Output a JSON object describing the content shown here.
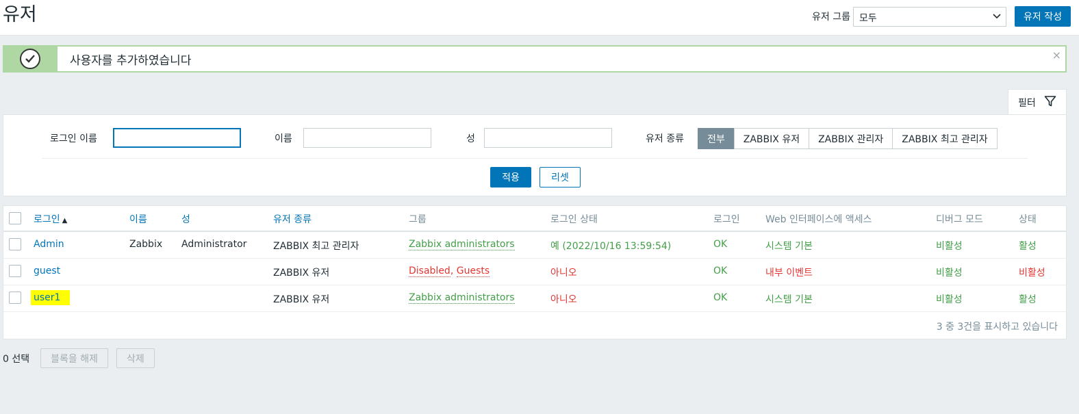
{
  "header": {
    "title": "유저",
    "group_label": "유저 그룹",
    "group_value": "모두",
    "create_label": "유저 작성"
  },
  "message": {
    "text": "사용자를 추가하였습니다",
    "close": "×"
  },
  "filter": {
    "tab_label": "필터",
    "login_label": "로그인 이름",
    "login_value": "",
    "name_label": "이름",
    "name_value": "",
    "surname_label": "성",
    "surname_value": "",
    "type_label": "유저 종류",
    "type_options": [
      "전부",
      "ZABBIX 유저",
      "ZABBIX 관리자",
      "ZABBIX 최고 관리자"
    ],
    "type_selected": "전부",
    "apply_label": "적용",
    "reset_label": "리셋"
  },
  "table": {
    "columns": {
      "login": "로그인",
      "name": "이름",
      "surname": "성",
      "type": "유저 종류",
      "groups": "그룹",
      "login_status": "로그인 상태",
      "frontend": "Web 인터페이스에 액세스",
      "debug": "디버그 모드",
      "status": "상태"
    },
    "rows": [
      {
        "login": "Admin",
        "name": "Zabbix",
        "surname": "Administrator",
        "type": "ZABBIX 최고 관리자",
        "group1": "Zabbix administrators",
        "login_status": "예 (2022/10/16 13:59:54)",
        "login_ok": "OK",
        "frontend": "시스템 기본",
        "debug": "비활성",
        "status": "활성"
      },
      {
        "login": "guest",
        "name": "",
        "surname": "",
        "type": "ZABBIX 유저",
        "group1": "Disabled",
        "group_sep": ", ",
        "group2": "Guests",
        "login_status": "아니오",
        "login_ok": "OK",
        "frontend": "내부 이벤트",
        "debug": "비활성",
        "status": "비활성"
      },
      {
        "login": "user1",
        "name": "",
        "surname": "",
        "type": "ZABBIX 유저",
        "group1": "Zabbix administrators",
        "login_status": "아니오",
        "login_ok": "OK",
        "frontend": "시스템 기본",
        "debug": "비활성",
        "status": "활성"
      }
    ],
    "stats": "3 중 3건을 표시하고 있습니다"
  },
  "footer": {
    "selected": "0 선택",
    "unblock_label": "블록을 해제",
    "delete_label": "삭제"
  }
}
